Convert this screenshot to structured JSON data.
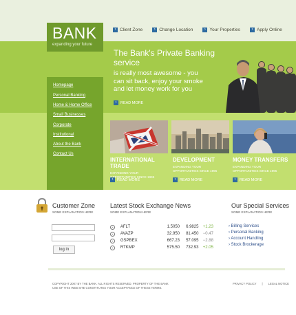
{
  "logo": {
    "title": "BANK",
    "tagline": "expanding your future"
  },
  "top_nav": [
    "Client Zone",
    "Change Location",
    "Your Properties",
    "Apply Online"
  ],
  "hero": {
    "title_line1": "The Bank's Private Banking",
    "title_line2": "service",
    "text_line1": "is really most awesome - you",
    "text_line2": "can sit back, enjoy your smoke",
    "text_line3": "and let money work for you",
    "read_more": "READ MORE"
  },
  "sidebar": [
    "Homepage",
    "Personal Banking",
    "Home & Home Office",
    "Small Businesses",
    "Corporate",
    "Institutional",
    "About the Bank",
    "Contact Us"
  ],
  "sections": [
    {
      "title": "INTERNATIONAL TRADE",
      "sub1": "EXPANDING YOUR",
      "sub2": "OPPORTUNITIES SINCE 1995",
      "read_more": "READ MORE"
    },
    {
      "title": "DEVELOPMENT",
      "sub1": "EXPANDING YOUR",
      "sub2": "OPPORTUNITIES SINCE 1995",
      "read_more": "READ MORE"
    },
    {
      "title": "MONEY TRANSFERS",
      "sub1": "EXPANDING YOUR",
      "sub2": "OPPORTUNITIES SINCE 1995",
      "read_more": "READ MORE"
    }
  ],
  "customer_zone": {
    "title": "Customer Zone",
    "sub": "SOME EXPLANATION HERE",
    "login_button": "log in",
    "username": "",
    "password": ""
  },
  "stocks": {
    "title": "Latest Stock Exchange News",
    "sub": "SOME EXPLANATION HERE",
    "rows": [
      {
        "name": "AFLT",
        "v1": "1.5050",
        "v2": "6.9825",
        "chg": "+1.23",
        "color": "#7cb342"
      },
      {
        "name": "AVAZP",
        "v1": "32.950",
        "v2": "81.450",
        "chg": "−0.47",
        "color": "#888888"
      },
      {
        "name": "GSPBEX",
        "v1": "667.23",
        "v2": "57.095",
        "chg": "−2.88",
        "color": "#888888"
      },
      {
        "name": "RTKMP",
        "v1": "575.50",
        "v2": "732.93",
        "chg": "+2.05",
        "color": "#7cb342"
      }
    ]
  },
  "services": {
    "title": "Our Special Services",
    "sub": "SOME EXPLANATION HERE",
    "items": [
      "Billing Services",
      "Personal Banking",
      "Account Handling",
      "Stock Brockerage"
    ]
  },
  "footer": {
    "copy1": "COPYRIGHT 2007 BY THE BANK. ALL RIGHTS RESERVED. PROPERTY OF THE BANK",
    "copy2": "USE OF THIS WEB SITE CONSTITUTES YOUR ACCEPTANCE OF THESE TERMS.",
    "privacy": "PRIVACY POLICY",
    "sep": "|",
    "legal": "LEGAL NOTICE"
  },
  "colors": {
    "dark_green": "#6f9a2c",
    "mid_green": "#a4cb4a",
    "light_green": "#c2df6f",
    "arrow_blue": "#2d6aa0"
  }
}
